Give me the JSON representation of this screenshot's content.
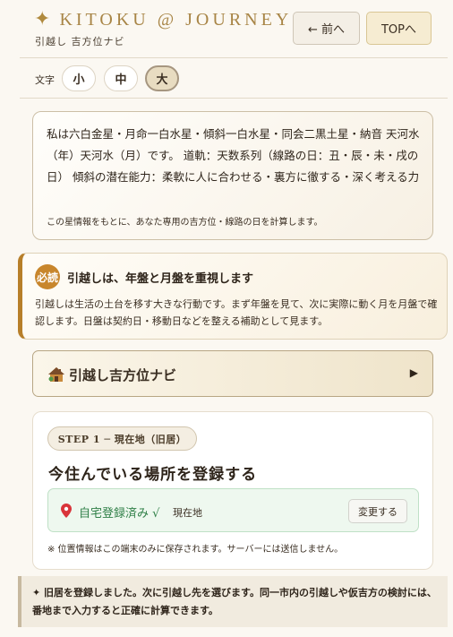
{
  "header": {
    "brand_title": "KITOKU @ JOURNEY",
    "subtitle": "引越し 吉方位ナビ",
    "prev_label": "← 前へ",
    "top_label": "TOPへ"
  },
  "font_size": {
    "label": "文字",
    "small": "小",
    "medium": "中",
    "large": "大",
    "selected": "大"
  },
  "profile": {
    "description": "私は六白金星・月命一白水星・傾斜一白水星・同会二黒土星・納音 天河水（年）天河水（月）です。 道軌：天数系列（線路の日：丑・辰・未・戌の日） 傾斜の潜在能力：柔軟に人に合わせる・裏方に徹する・深く考える力",
    "note": "この星情報をもとに、あなた専用の吉方位・線路の日を計算します。"
  },
  "must": {
    "badge": "必読",
    "title": "引越しは、年盤と月盤を重視します",
    "text": "引越しは生活の土台を移す大きな行動です。まず年盤を見て、次に実際に動く月を月盤で確認します。日盤は契約日・移動日などを整える補助として見ます。"
  },
  "navi": {
    "label": "引越し吉方位ナビ"
  },
  "step": {
    "pill": "STEP 1 ─ 現在地（旧居）",
    "title": "今住んでいる場所を登録する",
    "status": "自宅登録済み √",
    "location": "現在地",
    "change_label": "変更する",
    "note": "※ 位置情報はこの端末のみに保存されます。サーバーには送信しません。"
  },
  "notice": {
    "text": "✦ 旧居を登録しました。次に引越し先を選びます。同一市内の引越しや仮吉方の検討には、番地まで入力すると正確に計算できます。"
  },
  "colors": {
    "accent": "#b08a3e",
    "must_border": "#b77f2a",
    "success": "#2f7f47"
  }
}
